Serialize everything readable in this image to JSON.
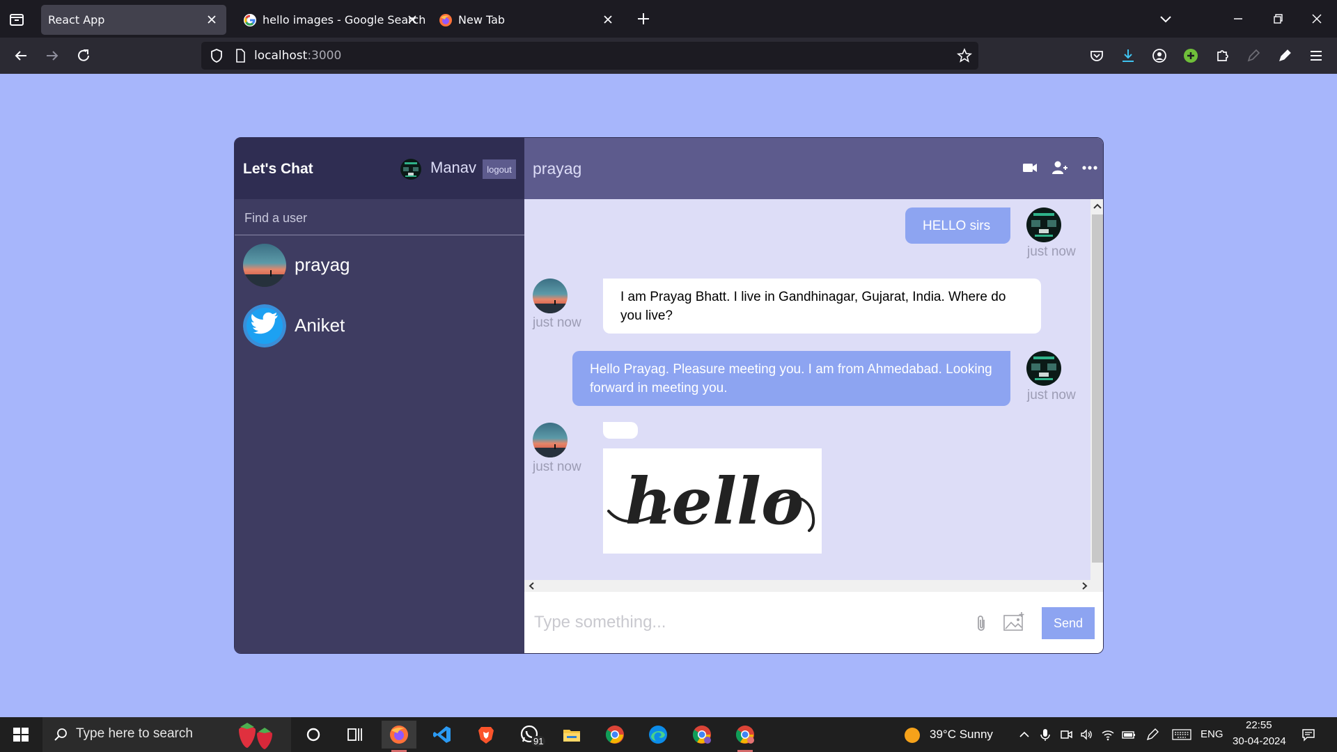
{
  "browser": {
    "tabs": [
      {
        "title": "React App",
        "active": true
      },
      {
        "title": "hello images - Google Search",
        "active": false
      },
      {
        "title": "New Tab",
        "active": false
      }
    ],
    "url": {
      "host": "localhost",
      "port": ":3000"
    }
  },
  "app": {
    "logo": "Let's Chat",
    "current_user": {
      "name": "Manav"
    },
    "logout_label": "logout",
    "search": {
      "placeholder": "Find a user"
    },
    "contacts": [
      {
        "name": "prayag"
      },
      {
        "name": "Aniket"
      }
    ],
    "chat": {
      "title": "prayag",
      "messages": [
        {
          "owner": true,
          "text": "HELLO sirs",
          "time": "just now"
        },
        {
          "owner": false,
          "text": "I am Prayag Bhatt. I live in Gandhinagar, Gujarat, India. Where do you live?",
          "time": "just now"
        },
        {
          "owner": true,
          "text": "Hello Prayag. Pleasure meeting you. I am from Ahmedabad. Looking forward in meeting you.",
          "time": "just now"
        },
        {
          "owner": false,
          "text": "",
          "time": "just now",
          "image_text": "hello"
        }
      ],
      "input_placeholder": "Type something...",
      "send_label": "Send"
    }
  },
  "taskbar": {
    "search_placeholder": "Type here to search",
    "whatsapp_badge": "91",
    "weather": "39°C  Sunny",
    "language": "ENG",
    "time": "22:55",
    "date": "30-04-2024"
  },
  "colors": {
    "page_bg": "#a7b6fb",
    "sidebar_bg": "#3e3c61",
    "navbar_bg": "#2f2d52",
    "chat_header_bg": "#5d5b8d",
    "messages_bg": "#ddddf7",
    "owner_bubble": "#8da4f1"
  }
}
